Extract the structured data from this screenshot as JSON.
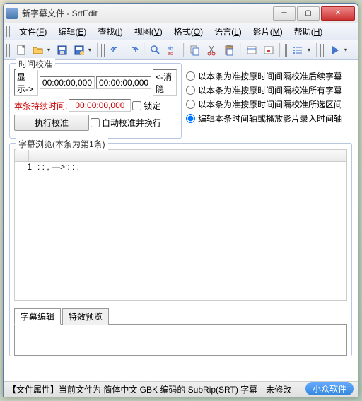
{
  "window": {
    "title": "新字幕文件 - SrtEdit"
  },
  "menus": [
    {
      "label": "文件",
      "key": "F"
    },
    {
      "label": "编辑",
      "key": "E"
    },
    {
      "label": "查找",
      "key": "I"
    },
    {
      "label": "视图",
      "key": "V"
    },
    {
      "label": "格式",
      "key": "O"
    },
    {
      "label": "语言",
      "key": "L"
    },
    {
      "label": "影片",
      "key": "M"
    },
    {
      "label": "帮助",
      "key": "H"
    }
  ],
  "time_calib": {
    "legend": "时间校准",
    "show_label": "显示->",
    "time1": "00:00:00,000",
    "time2": "00:00:00,000",
    "hide_label": "<-消隐",
    "duration_label": "本条持续时间:",
    "duration_value": "00:00:00,000",
    "lock_label": "锁定",
    "execute_label": "执行校准",
    "autowrap_label": "自动校准并换行"
  },
  "radios": {
    "r1": "以本条为准按原时间间隔校准后续字幕",
    "r2": "以本条为准按原时间间隔校准所有字幕",
    "r3": "以本条为准按原时间间隔校准所选区间",
    "r4": "编辑本条时间轴或播放影片录入时间轴"
  },
  "browse": {
    "legend": "字幕浏览(本条为第1条)",
    "row_num": "1",
    "row_text": " : : ,    —>    : : ,  "
  },
  "tabs": {
    "edit": "字幕编辑",
    "fx": "特效预览"
  },
  "status": {
    "text": "【文件属性】当前文件为 简体中文 GBK 编码的 SubRip(SRT) 字幕　未修改"
  },
  "watermark": "小众软件"
}
